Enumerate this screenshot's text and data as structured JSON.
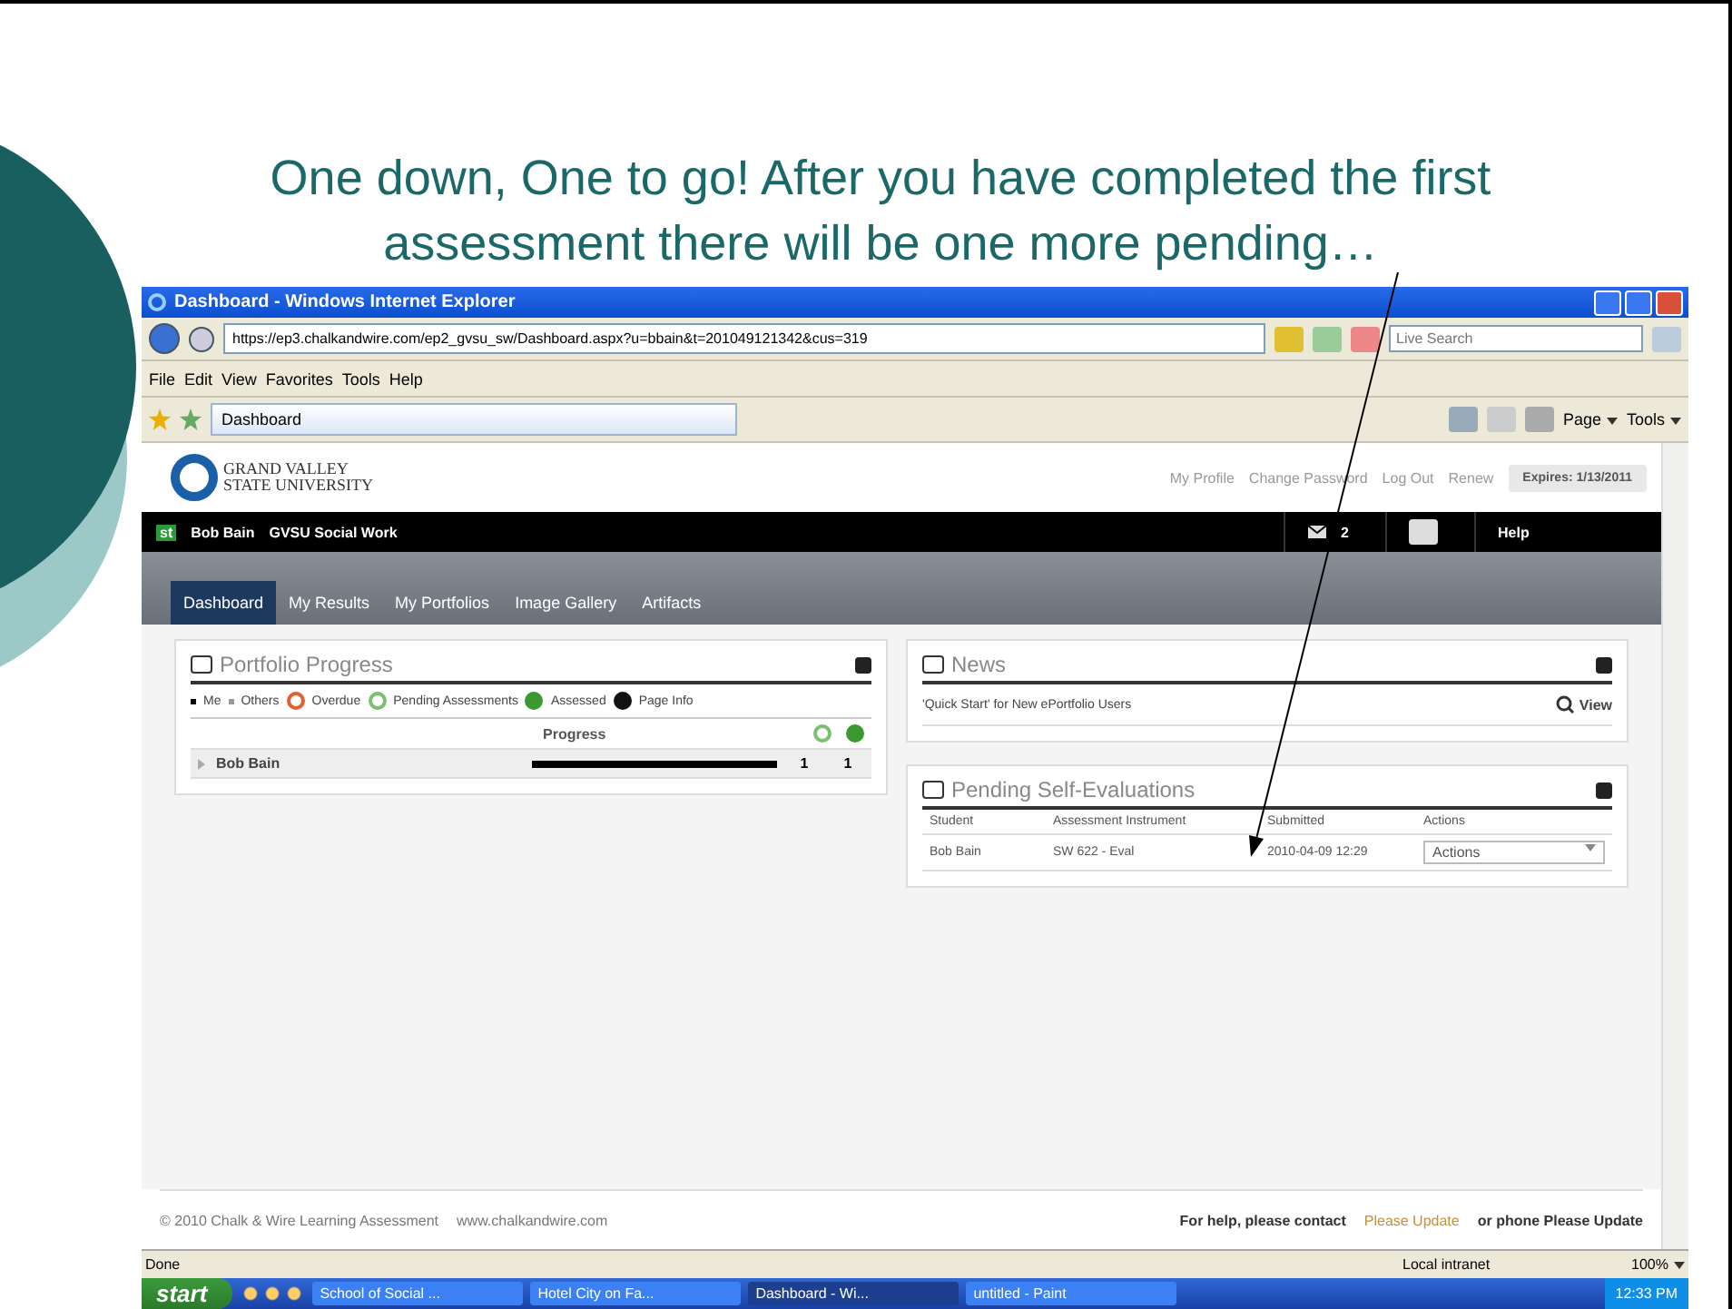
{
  "slide": {
    "title": "One down, One to go! After you have completed the first assessment there will be one more pending…"
  },
  "browser": {
    "title": "Dashboard - Windows Internet Explorer",
    "address": "https://ep3.chalkandwire.com/ep2_gvsu_sw/Dashboard.aspx?u=bbain&t=201049121342&cus=319",
    "search_placeholder": "Live Search",
    "menu": [
      "File",
      "Edit",
      "View",
      "Favorites",
      "Tools",
      "Help"
    ],
    "tab": "Dashboard",
    "toolbar": [
      "Page",
      "Tools"
    ],
    "status": "Done",
    "zone": "Local intranet",
    "zoom": "100%"
  },
  "site": {
    "logo_line1": "GRAND VALLEY",
    "logo_line2": "STATE UNIVERSITY",
    "links": [
      "My Profile",
      "Change Password",
      "Log Out",
      "Renew"
    ],
    "expires": "Expires: 1/13/2011",
    "user_badge": "st",
    "user": "Bob Bain",
    "program": "GVSU Social Work",
    "messages": "2",
    "help": "Help",
    "nav": [
      {
        "label": "Dashboard",
        "selected": true
      },
      {
        "label": "My Results",
        "selected": false
      },
      {
        "label": "My Portfolios",
        "selected": false
      },
      {
        "label": "Image Gallery",
        "selected": false
      },
      {
        "label": "Artifacts",
        "selected": false
      }
    ]
  },
  "portfolio": {
    "title": "Portfolio Progress",
    "legend": [
      {
        "kind": "dot",
        "label": "Me",
        "color": "#000000"
      },
      {
        "kind": "dot",
        "label": "Others",
        "color": "#999999"
      },
      {
        "kind": "overdue",
        "label": "Overdue"
      },
      {
        "kind": "pending",
        "label": "Pending Assessments"
      },
      {
        "kind": "assessed",
        "label": "Assessed"
      },
      {
        "kind": "info",
        "label": "Page Info"
      }
    ],
    "progress_header": "Progress",
    "rows": [
      {
        "name": "Bob Bain",
        "expanded": false,
        "level": 1,
        "pending": "1",
        "assessed": "1"
      }
    ]
  },
  "news": {
    "title": "News",
    "items": [
      {
        "text": "'Quick Start' for New ePortfolio Users",
        "action": "View"
      }
    ]
  },
  "pending": {
    "title": "Pending Self-Evaluations",
    "columns": [
      "Student",
      "Assessment Instrument",
      "Submitted",
      "Actions"
    ],
    "rows": [
      {
        "student": "Bob Bain",
        "instrument": "SW 622 - Eval",
        "submitted": "2010-04-09 12:29",
        "action": "Actions"
      }
    ]
  },
  "footer": {
    "copyright": "© 2010 Chalk & Wire Learning Assessment",
    "url": "www.chalkandwire.com",
    "help_prefix": "For help, please contact",
    "help_link": "Please Update",
    "help_suffix": "or phone Please Update"
  },
  "taskbar": {
    "start": "start",
    "tasks": [
      {
        "label": "School of Social ...",
        "selected": false
      },
      {
        "label": "Hotel City on Fa...",
        "selected": false
      },
      {
        "label": "Dashboard - Wi...",
        "selected": true
      },
      {
        "label": "untitled - Paint",
        "selected": false
      }
    ],
    "time": "12:33 PM"
  }
}
